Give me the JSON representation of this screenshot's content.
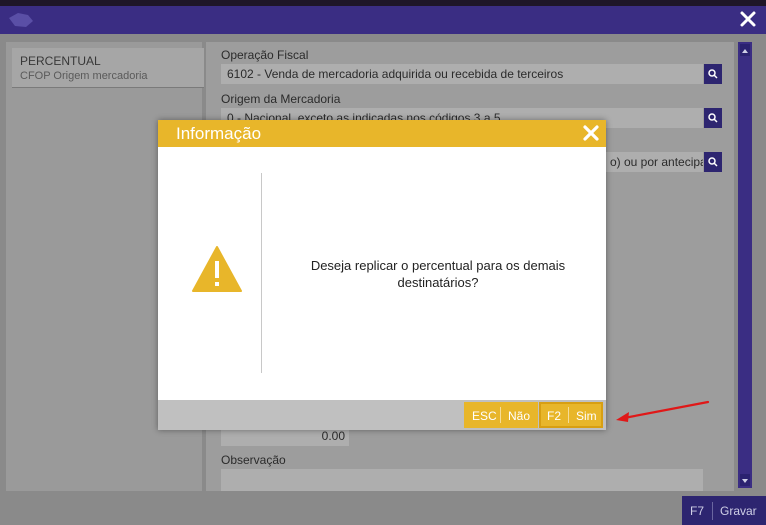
{
  "app": {
    "accent": "#3a2d83",
    "dialog_accent": "#e8b62a"
  },
  "sidebar": {
    "item_title": "PERCENTUAL",
    "item_subtitle": "CFOP Origem mercadoria"
  },
  "form": {
    "operacao_fiscal_label": "Operação Fiscal",
    "operacao_fiscal_value": "6102 - Venda de mercadoria adquirida ou recebida de terceiros",
    "origem_label": "Origem da Mercadoria",
    "origem_value": "0 - Nacional, exceto as indicadas nos códigos 3 a 5",
    "third_value_fragment": "o) ou por antecipac",
    "amount_value": "0.00",
    "observacao_label": "Observação"
  },
  "footer": {
    "save_key": "F7",
    "save_label": "Gravar"
  },
  "dialog": {
    "title": "Informação",
    "message": "Deseja replicar o percentual para os demais destinatários?",
    "icon": "warning-icon",
    "no_key": "ESC",
    "no_label": "Não",
    "yes_key": "F2",
    "yes_label": "Sim"
  }
}
